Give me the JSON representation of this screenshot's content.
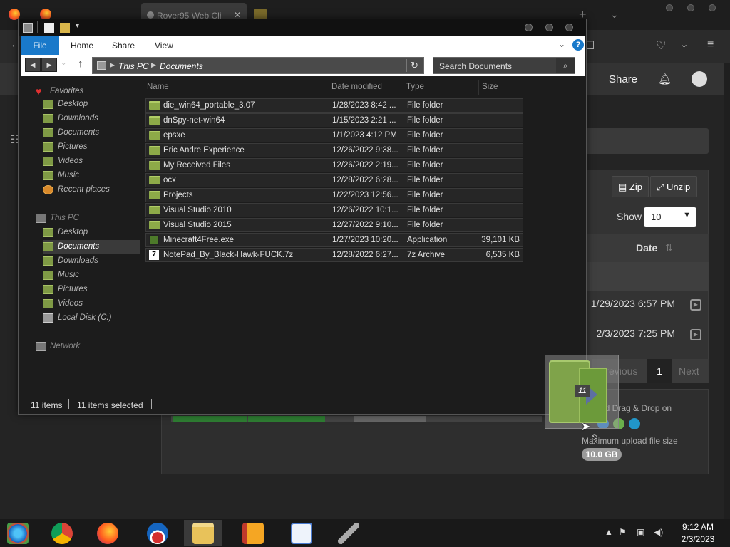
{
  "browser": {
    "tab_title": "Rover95 Web Cli",
    "tab_close": "✕",
    "new_tab": "+",
    "tab_list": "⌄"
  },
  "webapp": {
    "share_label": "Share",
    "zip_label": "Zip",
    "unzip_label": "Unzip",
    "show_label": "Show",
    "show_value": "10",
    "date_header": "Date",
    "dates": [
      "1/29/2023 6:57 PM",
      "2/3/2023 7:25 PM"
    ],
    "pager": {
      "prev": "Previous",
      "current": "1",
      "next": "Next"
    },
    "upload_dnd": "ad Drag & Drop on",
    "upload_max": "Maximum upload file size",
    "upload_size": "10.0 GB"
  },
  "explorer": {
    "ribbon_tabs": {
      "file": "File",
      "home": "Home",
      "share": "Share",
      "view": "View"
    },
    "help": "?",
    "breadcrumb": [
      "This PC",
      "Documents"
    ],
    "search_placeholder": "Search Documents",
    "nav": {
      "favorites": "Favorites",
      "fav_items": [
        "Desktop",
        "Downloads",
        "Documents",
        "Pictures",
        "Videos",
        "Music",
        "Recent places"
      ],
      "this_pc": "This PC",
      "pc_items": [
        "Desktop",
        "Documents",
        "Downloads",
        "Music",
        "Pictures",
        "Videos",
        "Local Disk (C:)"
      ],
      "network": "Network"
    },
    "columns": {
      "name": "Name",
      "date": "Date modified",
      "type": "Type",
      "size": "Size"
    },
    "files": [
      {
        "name": "die_win64_portable_3.07",
        "date": "1/28/2023 8:42 ...",
        "type": "File folder",
        "size": "",
        "icon": "folder-icon"
      },
      {
        "name": "dnSpy-net-win64",
        "date": "1/15/2023 2:21 ...",
        "type": "File folder",
        "size": "",
        "icon": "folder-icon"
      },
      {
        "name": "epsxe",
        "date": "1/1/2023 4:12 PM",
        "type": "File folder",
        "size": "",
        "icon": "folder-icon"
      },
      {
        "name": "Eric Andre Experience",
        "date": "12/26/2022 9:38...",
        "type": "File folder",
        "size": "",
        "icon": "folder-icon"
      },
      {
        "name": "My Received Files",
        "date": "12/26/2022 2:19...",
        "type": "File folder",
        "size": "",
        "icon": "folder-icon"
      },
      {
        "name": "ocx",
        "date": "12/28/2022 6:28...",
        "type": "File folder",
        "size": "",
        "icon": "folder-icon"
      },
      {
        "name": "Projects",
        "date": "1/22/2023 12:56...",
        "type": "File folder",
        "size": "",
        "icon": "folder-icon"
      },
      {
        "name": "Visual Studio 2010",
        "date": "12/26/2022 10:1...",
        "type": "File folder",
        "size": "",
        "icon": "folder-icon"
      },
      {
        "name": "Visual Studio 2015",
        "date": "12/27/2022 9:10...",
        "type": "File folder",
        "size": "",
        "icon": "folder-icon"
      },
      {
        "name": "Minecraft4Free.exe",
        "date": "1/27/2023 10:20...",
        "type": "Application",
        "size": "39,101 KB",
        "icon": "exe-icon"
      },
      {
        "name": "NotePad_By_Black-Hawk-FUCK.7z",
        "date": "12/28/2022 6:27...",
        "type": "7z Archive",
        "size": "6,535 KB",
        "icon": "archive-icon"
      }
    ],
    "status": {
      "items": "11 items",
      "selected": "11 items selected"
    }
  },
  "drag": {
    "count": "11"
  },
  "taskbar": {
    "time": "9:12 AM",
    "date": "2/3/2023",
    "apps": [
      "start-icon",
      "chrome-icon",
      "firefox-icon",
      "obama-icon",
      "file-explorer-icon",
      "book-icon",
      "wordpad-icon",
      "jet-icon"
    ]
  }
}
